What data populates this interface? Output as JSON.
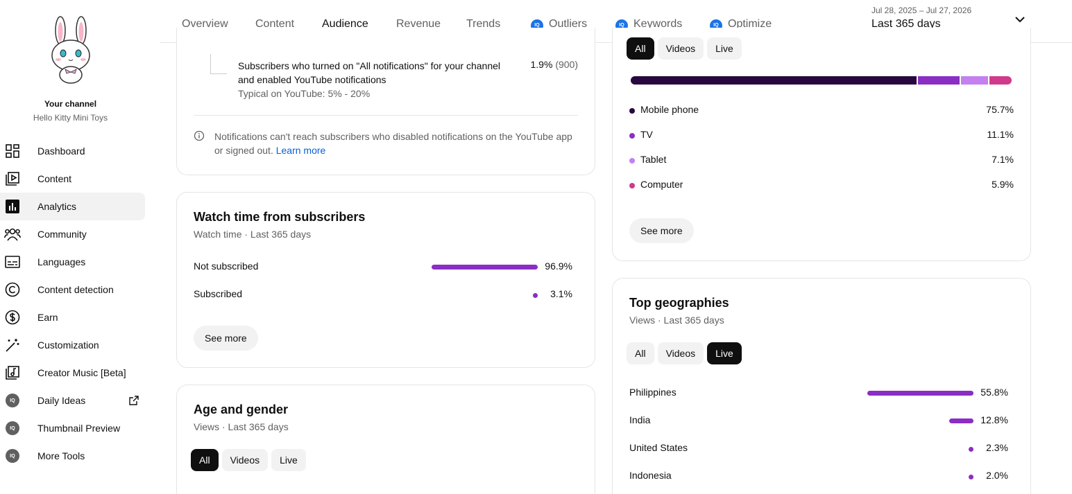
{
  "sidebar": {
    "channel_title": "Your channel",
    "channel_name": "Hello Kitty Mini Toys",
    "items": [
      {
        "label": "Dashboard",
        "icon": "dashboard-icon"
      },
      {
        "label": "Content",
        "icon": "content-icon"
      },
      {
        "label": "Analytics",
        "icon": "analytics-icon",
        "active": true
      },
      {
        "label": "Community",
        "icon": "community-icon"
      },
      {
        "label": "Languages",
        "icon": "subtitles-icon"
      },
      {
        "label": "Content detection",
        "icon": "copyright-icon"
      },
      {
        "label": "Earn",
        "icon": "dollar-icon"
      },
      {
        "label": "Customization",
        "icon": "magic-wand-icon"
      },
      {
        "label": "Creator Music [Beta]",
        "icon": "music-icon"
      },
      {
        "label": "Daily Ideas",
        "icon": "iq-icon",
        "external": true
      },
      {
        "label": "Thumbnail Preview",
        "icon": "iq-icon"
      },
      {
        "label": "More Tools",
        "icon": "iq-icon"
      }
    ],
    "iq_badge": "IQ"
  },
  "tabs": [
    {
      "label": "Overview"
    },
    {
      "label": "Content"
    },
    {
      "label": "Audience",
      "active": true
    },
    {
      "label": "Revenue"
    },
    {
      "label": "Trends"
    },
    {
      "label": "Outliers",
      "iq": true
    },
    {
      "label": "Keywords",
      "iq": true
    },
    {
      "label": "Optimize",
      "iq": true
    }
  ],
  "date_range": {
    "dates": "Jul 28, 2025 – Jul 27, 2026",
    "label": "Last 365 days"
  },
  "notifications_card": {
    "line1": "Subscribers who turned on \"All notifications\" for your channel",
    "line2": "and enabled YouTube notifications",
    "typical": "Typical on YouTube: 5% - 20%",
    "value": "1.9%",
    "count": "(900)",
    "info_line1": "Notifications can't reach subscribers who disabled notifications on the YouTube app",
    "info_line2": "or signed out.",
    "learn_more": "Learn more"
  },
  "watch_time_card": {
    "title": "Watch time from subscribers",
    "subtitle": "Watch time · Last 365 days",
    "rows": [
      {
        "label": "Not subscribed",
        "value": "96.9%",
        "fraction": 0.969
      },
      {
        "label": "Subscribed",
        "value": "3.1%",
        "fraction": 0.031
      }
    ],
    "see_more": "See more"
  },
  "age_gender_card": {
    "title": "Age and gender",
    "subtitle": "Views · Last 365 days",
    "filters": [
      "All",
      "Videos",
      "Live"
    ],
    "selected": "All"
  },
  "device_card": {
    "filters": [
      "All",
      "Videos",
      "Live"
    ],
    "selected": "All",
    "rows": [
      {
        "label": "Mobile phone",
        "value": "75.7%",
        "color": "#28083f",
        "fraction": 0.757
      },
      {
        "label": "TV",
        "value": "11.1%",
        "color": "#8b2ec4",
        "fraction": 0.111
      },
      {
        "label": "Tablet",
        "value": "7.1%",
        "color": "#c47ff0",
        "fraction": 0.071
      },
      {
        "label": "Computer",
        "value": "5.9%",
        "color": "#d03a8c",
        "fraction": 0.059
      }
    ],
    "see_more": "See more"
  },
  "geo_card": {
    "title": "Top geographies",
    "subtitle": "Views · Last 365 days",
    "filters": [
      "All",
      "Videos",
      "Live"
    ],
    "selected": "Live",
    "rows": [
      {
        "label": "Philippines",
        "value": "55.8%",
        "fraction": 0.558
      },
      {
        "label": "India",
        "value": "12.8%",
        "fraction": 0.128
      },
      {
        "label": "United States",
        "value": "2.3%",
        "fraction": 0.023
      },
      {
        "label": "Indonesia",
        "value": "2.0%",
        "fraction": 0.02
      }
    ]
  }
}
